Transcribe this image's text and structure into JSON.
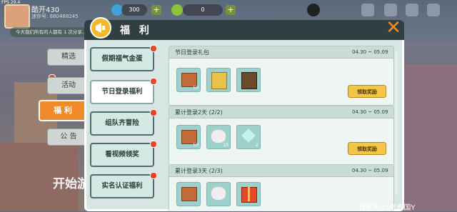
{
  "top_bar": {
    "fps": "FPS 29.4",
    "username": "酷开430",
    "uid": "迷你号: 880488245",
    "coins": "300",
    "beans": "0"
  },
  "notice": "今天我们所有的人都有 1 次分享...",
  "categories": [
    {
      "label": "精选",
      "active": false
    },
    {
      "label": "活动",
      "active": false
    },
    {
      "label": "福 利",
      "active": true
    },
    {
      "label": "公 告",
      "active": false
    }
  ],
  "start_text": "开始游",
  "panel": {
    "title": "福 利",
    "sidebar": [
      {
        "label": "假期福气金蛋",
        "active": false
      },
      {
        "label": "节日登录福利",
        "active": true
      },
      {
        "label": "组队齐冒险",
        "active": false
      },
      {
        "label": "看视频领奖",
        "active": false
      },
      {
        "label": "实名认证福利",
        "active": false
      }
    ],
    "rows": [
      {
        "title": "节日登录礼包",
        "date": "04.30 ~ 05.09",
        "button": "领取奖励",
        "items": [
          {
            "icon": "treasure-chest-icon",
            "count": "50"
          },
          {
            "icon": "gold-block-icon",
            "count": ""
          },
          {
            "icon": "wood-crate-icon",
            "count": ""
          }
        ]
      },
      {
        "title": "累计登录2天 (2/2)",
        "date": "04.30 ~ 05.09",
        "button": "领取奖励",
        "items": [
          {
            "icon": "treasure-chest-icon",
            "count": "50"
          },
          {
            "icon": "white-pet-icon",
            "count": "10"
          },
          {
            "icon": "gem-icon",
            "count": "2"
          }
        ]
      },
      {
        "title": "累计登录3天 (2/3)",
        "date": "04.30 ~ 05.09",
        "button": "",
        "items": [
          {
            "icon": "treasure-chest-icon",
            "count": ""
          },
          {
            "icon": "white-pet-icon",
            "count": ""
          },
          {
            "icon": "gift-box-icon",
            "count": ""
          }
        ]
      }
    ]
  },
  "watermark": "百家号/六老表国Y",
  "colors": {
    "accent": "#f18a2a",
    "panel_bg": "#d7e6e2",
    "claim_button": "#f3c64a",
    "red_dot": "#e4452f"
  }
}
